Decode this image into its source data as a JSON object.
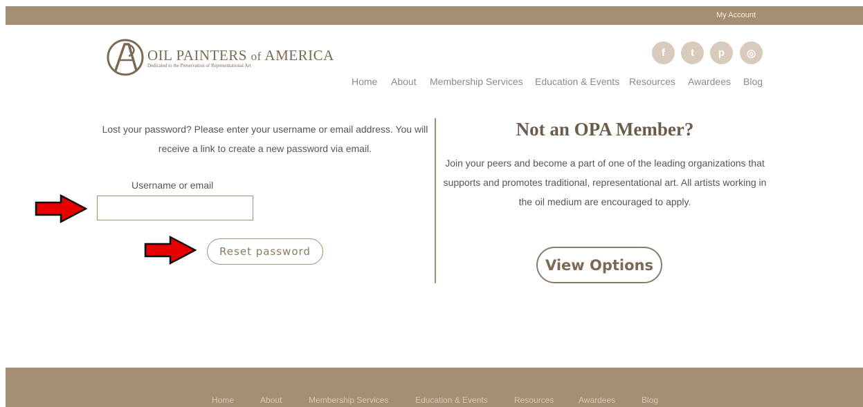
{
  "top_bar": {
    "account_link": "My Account"
  },
  "logo": {
    "title_oil": "OIL",
    "title_painters": "PAINTERS",
    "title_of": "of",
    "title_america": "AMERICA",
    "tagline": "Dedicated to the Preservation of Representational Art"
  },
  "social": {
    "facebook": "f",
    "twitter": "t",
    "pinterest": "p",
    "instagram": "◎"
  },
  "nav": {
    "items": [
      "Home",
      "About",
      "Membership Services",
      "Education & Events",
      "Resources",
      "Awardees",
      "Blog"
    ]
  },
  "reset_form": {
    "instructions": "Lost your password? Please enter your username or email address. You will receive a link to create a new password via email.",
    "field_label": "Username or email",
    "field_value": "",
    "button_label": "Reset password"
  },
  "promo": {
    "title": "Not an OPA Member?",
    "text": "Join your peers and become a part of one of the leading organizations that supports and promotes traditional, representational art. All artists working in the oil medium are encouraged to apply.",
    "button_label": "View Options"
  },
  "footer": {
    "items": [
      "Home",
      "About",
      "Membership Services",
      "Education & Events",
      "Resources",
      "Awardees",
      "Blog"
    ]
  },
  "colors": {
    "brand": "#a58f73",
    "arrow": "#e60000",
    "text": "#555555"
  },
  "icons": {
    "annotation_arrows": "red-right-arrow-icon",
    "logo_mark": "opa-monogram-icon"
  }
}
